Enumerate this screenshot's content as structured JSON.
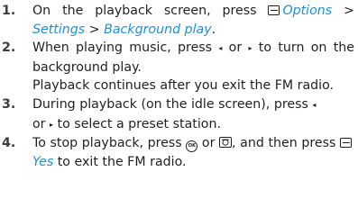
{
  "steps": [
    {
      "num": "1.",
      "t1": "On the playback screen, press ",
      "options": "Options",
      "sep1": " > ",
      "settings": "Settings",
      "sep2": " > ",
      "bgplay": "Background play",
      "end": "."
    },
    {
      "num": "2.",
      "t1": "When playing music, press ",
      "left_arrow": "◂",
      "or": " or ",
      "right_arrow": "▸",
      "t2": " to turn on the background play.",
      "t3": "Playback continues after you exit the FM radio."
    },
    {
      "num": "3.",
      "t1": "During playback (on the idle screen), press ",
      "left_arrow": "◂",
      "or": " or ",
      "right_arrow": "▸",
      "t2": " to select a preset station."
    },
    {
      "num": "4.",
      "t1": "To stop playback, press ",
      "ok_symbol": "OK",
      "or": " or ",
      "t2": ", and then press ",
      "yes": "Yes",
      "t3": " to exit the FM radio."
    }
  ],
  "icons": {
    "softkey": "left-softkey-icon",
    "ok": "ok-key-icon",
    "end": "end-call-key-icon",
    "arrow_left": "left-navigation-arrow-icon",
    "arrow_right": "right-navigation-arrow-icon"
  },
  "colors": {
    "text": "#231f20",
    "menu_italic": "#1e90d6"
  }
}
